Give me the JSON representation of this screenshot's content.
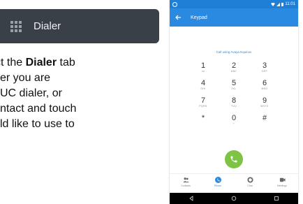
{
  "dialer_tab": {
    "label": "Dialer",
    "icon": "grid-icon"
  },
  "instructions": {
    "line1_prefix": "ct the ",
    "line1_bold": "Dialer",
    "line1_suffix": " tab",
    "line2": "er you are",
    "line3": "UC dialer, or",
    "line4": "ntact and touch",
    "line5": "ld like to use to"
  },
  "phone": {
    "status_time": "11:01",
    "app_bar_title": "Keypad",
    "call_using": "Call using Avaya Equinox",
    "keys": [
      {
        "digit": "1",
        "sub": "oo"
      },
      {
        "digit": "2",
        "sub": "ABC"
      },
      {
        "digit": "3",
        "sub": "DEF"
      },
      {
        "digit": "4",
        "sub": "GHI"
      },
      {
        "digit": "5",
        "sub": "JKL"
      },
      {
        "digit": "6",
        "sub": "MNO"
      },
      {
        "digit": "7",
        "sub": "PQRS"
      },
      {
        "digit": "8",
        "sub": "TUV"
      },
      {
        "digit": "9",
        "sub": "WXYZ"
      },
      {
        "digit": "*",
        "sub": ""
      },
      {
        "digit": "0",
        "sub": "+"
      },
      {
        "digit": "#",
        "sub": ""
      }
    ],
    "nav": [
      {
        "label": "Contacts",
        "icon": "contacts-icon"
      },
      {
        "label": "Phone",
        "icon": "phone-icon"
      },
      {
        "label": "Chat",
        "icon": "chat-icon"
      },
      {
        "label": "Meetings",
        "icon": "meetings-icon"
      }
    ]
  },
  "colors": {
    "accent": "#2a8ae2",
    "call_green": "#7ec341",
    "chip_bg": "#3a4048"
  }
}
